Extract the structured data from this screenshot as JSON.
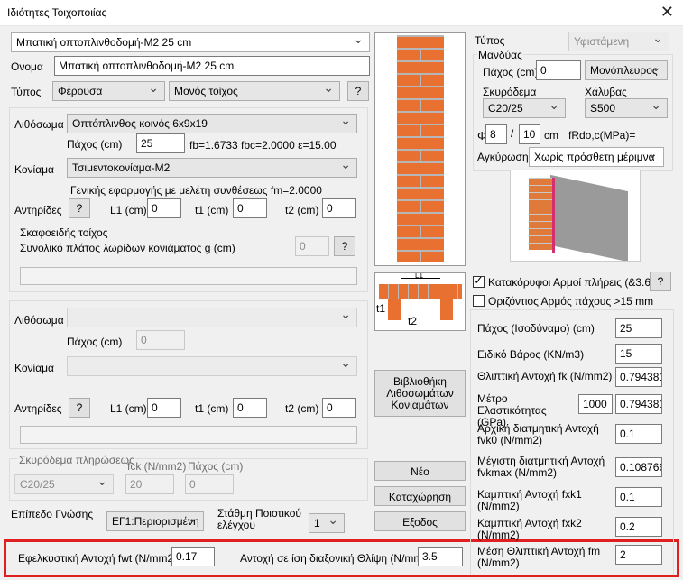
{
  "window": {
    "title": "Ιδιότητες Τοιχοποιίας",
    "close_glyph": "✕"
  },
  "top": {
    "preset": "Μπατική οπτοπλινθοδομή-M2 25 cm",
    "name_label": "Ονομα",
    "name_value": "Μπατική οπτοπλινθοδομή-M2 25 cm",
    "type_label": "Τύπος",
    "type_value": "Φέρουσα",
    "layer_value": "Μονός τοίχος",
    "help": "?"
  },
  "layer1": {
    "masonry_label": "Λιθόσωμα",
    "masonry_value": "Οπτόπλινθος κοινός 6x9x19",
    "thickness_label": "Πάχος (cm)",
    "thickness_value": "25",
    "fb_text": "fb=1.6733 fbc=2.0000 ε=15.00",
    "mortar_label": "Κονίαμα",
    "mortar_value": "Τσιμεντοκονίαμα-M2",
    "mortar_note": "Γενικής εφαρμογής με μελέτη συνθέσεως fm=2.0000",
    "buttress_label": "Αντηρίδες",
    "help": "?",
    "l1_label": "L1 (cm)",
    "l1_value": "0",
    "t1_label": "t1 (cm)",
    "t1_value": "0",
    "t2_label": "t2 (cm)",
    "t2_value": "0",
    "hollow_label": "Σκαφοειδής τοίχος",
    "hollow_width_label": "Συνολικό πλάτος λωρίδων κονιάματος g (cm)",
    "hollow_width_value": "0"
  },
  "layer2": {
    "masonry_label": "Λιθόσωμα",
    "thickness_label": "Πάχος (cm)",
    "thickness_value": "0",
    "mortar_label": "Κονίαμα",
    "buttress_label": "Αντηρίδες",
    "help": "?",
    "l1_label": "L1 (cm)",
    "l1_value": "0",
    "t1_label": "t1 (cm)",
    "t1_value": "0",
    "t2_label": "t2 (cm)",
    "t2_value": "0"
  },
  "fill": {
    "concrete_label": "Σκυρόδεμα πληρώσεως",
    "concrete_value": "C20/25",
    "fck_label": "fck (N/mm2)",
    "fck_value": "20",
    "thick_label": "Πάχος (cm)",
    "thick_value": "0"
  },
  "knowledge": {
    "label": "Επίπεδο Γνώσης",
    "value": "ΕΓ1:Περιορισμένη",
    "quality_label": "Στάθμη Ποιοτικού ελέγχου",
    "quality_value": "1"
  },
  "bottom": {
    "fwt_label": "Εφελκυστική Αντοχή fwt (N/mm2)",
    "fwt_value": "0.17",
    "diag_label": "Αντοχή σε ίση διαξονική Θλίψη (N/mm2)",
    "diag_value": "3.5"
  },
  "buttons": {
    "library": "Βιβλιοθήκη Λιθοσωμάτων Κονιαμάτων",
    "new": "Νέο",
    "save": "Καταχώρηση",
    "exit": "Εξοδος"
  },
  "jacket": {
    "type_label": "Τύπος",
    "type_value": "Υφιστάμενη",
    "group_label": "Μανδύας",
    "thickness_label": "Πάχος (cm)",
    "thickness_value": "0",
    "sides_value": "Μονόπλευρος",
    "concrete_label": "Σκυρόδεμα",
    "concrete_value": "C20/25",
    "steel_label": "Χάλυβας",
    "steel_value": "S500",
    "phi_label": "Φ",
    "phi_value": "8",
    "slash": "/",
    "spacing_value": "10",
    "cm_label": "cm",
    "frdo_label": "fRdo,c(MPa)=",
    "anchor_label": "Αγκύρωση",
    "anchor_value": "Χωρίς πρόσθετη μέριμνα"
  },
  "joints": {
    "vertical_label": "Κατακόρυφοι Αρμοί πλήρεις (&3.6.2)",
    "vertical_checked": true,
    "help": "?",
    "horizontal_label": "Οριζόντιος Αρμός πάχους >15 mm",
    "horizontal_checked": false
  },
  "diagram": {
    "l1": "L1",
    "t1": "t1",
    "t2": "t2"
  },
  "props": [
    {
      "label": "Πάχος (Ισοδύναμο) (cm)",
      "value": "25"
    },
    {
      "label": "Ειδικό Βάρος (KN/m3)",
      "value": "15"
    },
    {
      "label": "Θλιπτική Αντοχή fk (N/mm2)",
      "value": "0.794381"
    },
    {
      "label": "Μέτρο Ελαστικότητας (GPa)",
      "value": "0.794381",
      "extra": "1000"
    },
    {
      "label": "Αρχική διατμητική Αντοχή fvk0 (N/mm2)",
      "value": "0.1"
    },
    {
      "label": "Μέγιστη διατμητική Αντοχή fvkmax (N/mm2)",
      "value": "0.108766"
    },
    {
      "label": "Καμπτική Αντοχή  fxk1 (N/mm2)",
      "value": "0.1"
    },
    {
      "label": "Καμπτική Αντοχή  fxk2 (N/mm2)",
      "value": "0.2"
    },
    {
      "label": "Μέση Θλιπτική Αντοχή fm (N/mm2)",
      "value": "2"
    }
  ]
}
